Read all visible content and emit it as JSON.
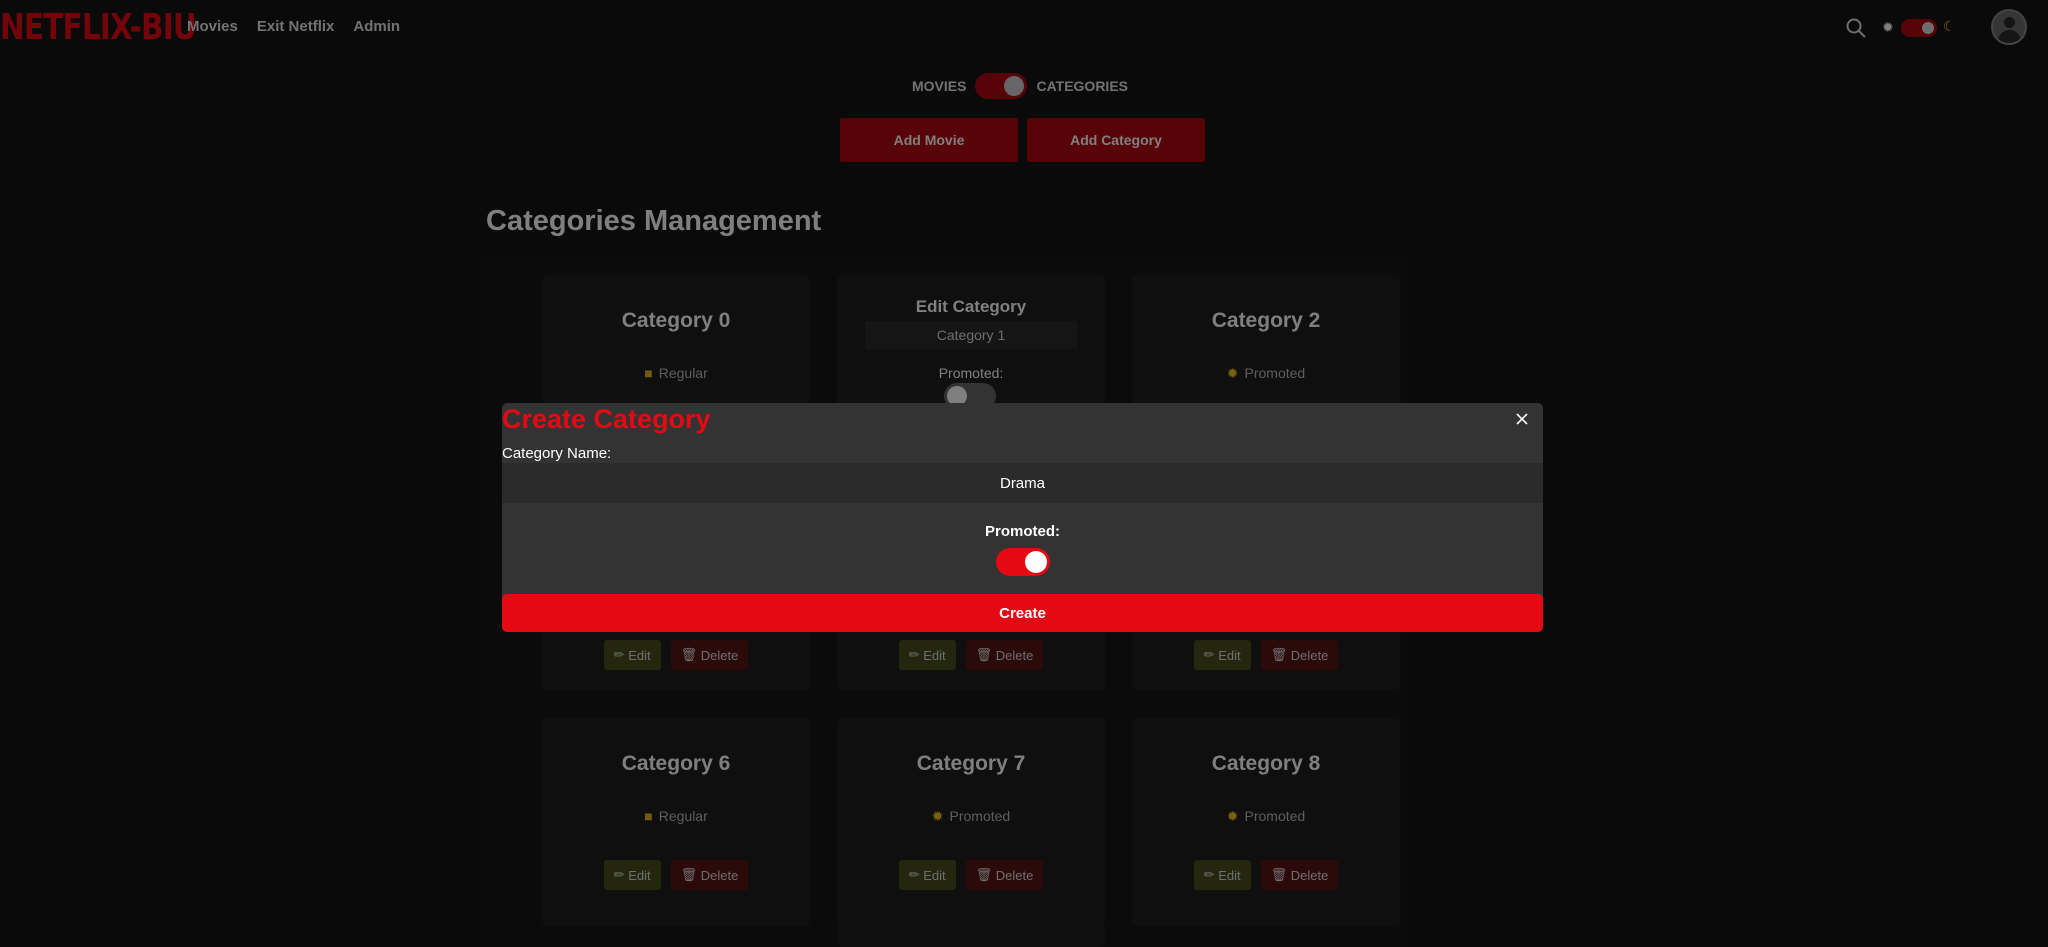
{
  "nav": {
    "logo": "NETFLIX-BIU",
    "links": [
      "Movies",
      "Exit Netflix",
      "Admin"
    ],
    "icons": {
      "search": "search-icon",
      "sun": "sun-icon",
      "moon": "moon-icon",
      "avatar": "avatar-icon"
    },
    "theme_toggle_on": true
  },
  "mode_switch": {
    "left_label": "MOVIES",
    "right_label": "CATEGORIES",
    "on": true
  },
  "actions": {
    "add_movie": "Add Movie",
    "add_category": "Add Category"
  },
  "section": {
    "title": "Categories Management"
  },
  "cards": [
    {
      "name": "Category 0",
      "status": "Regular",
      "icon": "folder-icon"
    },
    {
      "name": "Category 2",
      "status": "Promoted",
      "icon": "star-icon"
    },
    {
      "name": "Category 6",
      "status": "Regular",
      "icon": "folder-icon"
    },
    {
      "name": "Category 7",
      "status": "Promoted",
      "icon": "star-icon"
    },
    {
      "name": "Category 8",
      "status": "Promoted",
      "icon": "star-icon"
    }
  ],
  "edit_card": {
    "title": "Edit Category",
    "input_value": "Category 1",
    "promoted_label": "Promoted:",
    "promoted_on": false
  },
  "card_buttons": {
    "edit": "Edit",
    "delete": "Delete"
  },
  "modal": {
    "title": "Create Category",
    "name_label": "Category Name:",
    "name_value": "Drama",
    "promoted_label": "Promoted:",
    "promoted_on": true,
    "submit_label": "Create"
  },
  "colors": {
    "accent": "#e50914",
    "dark_accent": "#b00710",
    "background": "#141414"
  }
}
